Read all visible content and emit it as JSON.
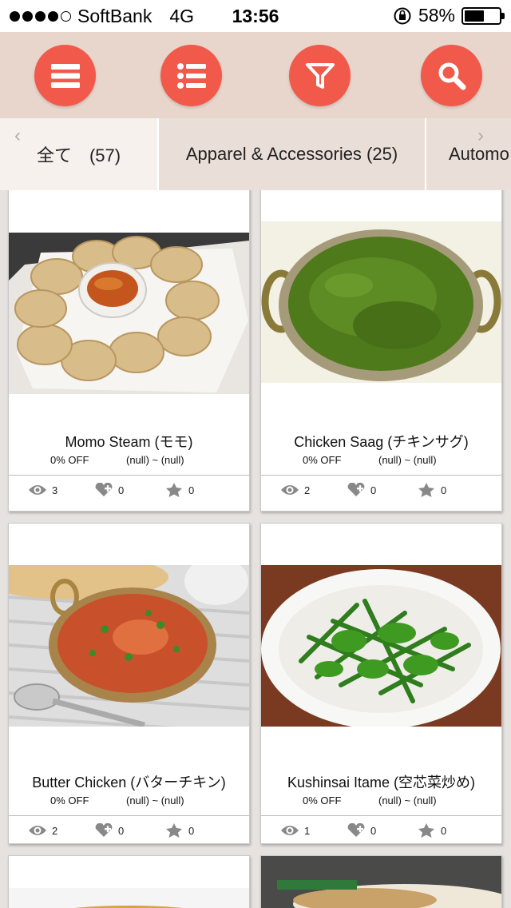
{
  "status": {
    "carrier": "SoftBank",
    "network": "4G",
    "time": "13:56",
    "battery": "58%",
    "battery_level": 0.58
  },
  "toolbar": {
    "icons": [
      "menu-icon",
      "list-icon",
      "filter-icon",
      "search-icon"
    ],
    "accent": "#f15a4a",
    "background": "#e8d6cc"
  },
  "tabs": [
    {
      "label": "全て　(57)"
    },
    {
      "label": "Apparel & Accessories (25)"
    },
    {
      "label": "Automo"
    }
  ],
  "products": [
    {
      "name": "Momo Steam (モモ)",
      "discount": "0% OFF",
      "range": "(null) ~ (null)",
      "views": "3",
      "likes": "0",
      "favorites": "0"
    },
    {
      "name": "Chicken Saag (チキンサグ)",
      "discount": "0% OFF",
      "range": "(null) ~ (null)",
      "views": "2",
      "likes": "0",
      "favorites": "0"
    },
    {
      "name": "Butter Chicken (バターチキン)",
      "discount": "0% OFF",
      "range": "(null) ~ (null)",
      "views": "2",
      "likes": "0",
      "favorites": "0"
    },
    {
      "name": "Kushinsai Itame (空芯菜炒め)",
      "discount": "0% OFF",
      "range": "(null) ~ (null)",
      "views": "1",
      "likes": "0",
      "favorites": "0"
    }
  ]
}
